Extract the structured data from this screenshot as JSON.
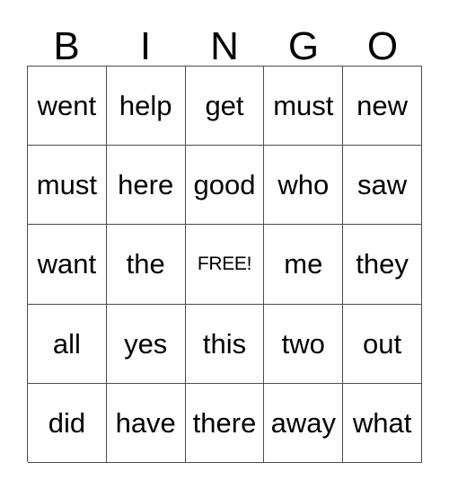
{
  "card": {
    "header_letters": [
      "B",
      "I",
      "N",
      "G",
      "O"
    ],
    "rows": [
      [
        "went",
        "help",
        "get",
        "must",
        "new"
      ],
      [
        "must",
        "here",
        "good",
        "who",
        "saw"
      ],
      [
        "want",
        "the",
        "FREE!",
        "me",
        "they"
      ],
      [
        "all",
        "yes",
        "this",
        "two",
        "out"
      ],
      [
        "did",
        "have",
        "there",
        "away",
        "what"
      ]
    ],
    "free_space": {
      "row": 2,
      "column": 2,
      "label": "FREE!"
    },
    "colors": {
      "background": "#ffffff",
      "border": "#4d4d4d",
      "text": "#000000"
    }
  }
}
